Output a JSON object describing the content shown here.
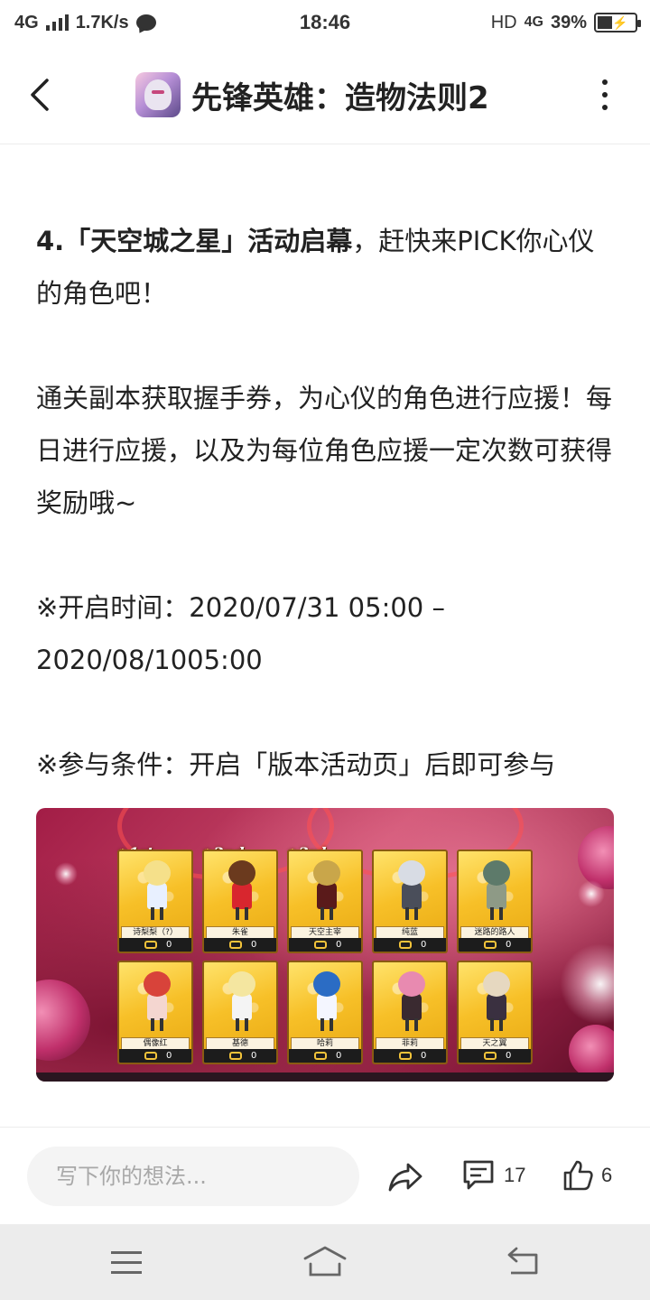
{
  "status_bar": {
    "network_left": "4G",
    "speed": "1.7K/s",
    "time": "18:46",
    "hd": "HD",
    "network_right": "4G",
    "battery": "39%",
    "battery_level": 0.39,
    "icons": [
      "signal-icon",
      "chat-icon",
      "battery-icon"
    ]
  },
  "header": {
    "title": "先锋英雄：造物法则2",
    "icons": [
      "back-arrow-icon",
      "app-avatar",
      "more-vertical-icon"
    ]
  },
  "article": {
    "p1_bold": "4.「天空城之星」活动启幕",
    "p1_rest": "，赶快来PICK你心仪的角色吧！",
    "p2": "通关副本获取握手券，为心仪的角色进行应援！每日进行应援，以及为每位角色应援一定次数可获得奖励哦~",
    "p3": "※开启时间：2020/07/31 05:00 – 2020/08/1005:00",
    "p4": "※参与条件：开启「版本活动页」后即可参与"
  },
  "banner": {
    "ranks": [
      "1st",
      "2nd",
      "3rd"
    ],
    "cards": [
      {
        "name": "诗梨梨（?）",
        "count": "0",
        "hair": "#f5e08a",
        "outfit": "#e8f0ff"
      },
      {
        "name": "朱雀",
        "count": "0",
        "hair": "#6b3a1e",
        "outfit": "#d8262e"
      },
      {
        "name": "天空主宰",
        "count": "0",
        "hair": "#c9a64a",
        "outfit": "#5a1a1a"
      },
      {
        "name": "纯蓝",
        "count": "0",
        "hair": "#d8dce4",
        "outfit": "#4a4e5a"
      },
      {
        "name": "迷路的路人",
        "count": "0",
        "hair": "#5d7a6a",
        "outfit": "#8e9a86"
      },
      {
        "name": "偶像红",
        "count": "0",
        "hair": "#d8433a",
        "outfit": "#f4d6d0"
      },
      {
        "name": "基德",
        "count": "0",
        "hair": "#f4e6a0",
        "outfit": "#f4f4f4"
      },
      {
        "name": "哈莉",
        "count": "0",
        "hair": "#2b6cc4",
        "outfit": "#f4f6ff"
      },
      {
        "name": "菲莉",
        "count": "0",
        "hair": "#e88ab0",
        "outfit": "#3a2a30"
      },
      {
        "name": "天之翼",
        "count": "0",
        "hair": "#e6d8c0",
        "outfit": "#3a3040"
      }
    ]
  },
  "actions": {
    "comment_placeholder": "写下你的想法...",
    "comment_count": "17",
    "like_count": "6",
    "icons": [
      "share-icon",
      "comment-icon",
      "like-icon"
    ]
  },
  "system_nav": {
    "icons": [
      "menu-icon",
      "home-icon",
      "back-icon"
    ]
  }
}
